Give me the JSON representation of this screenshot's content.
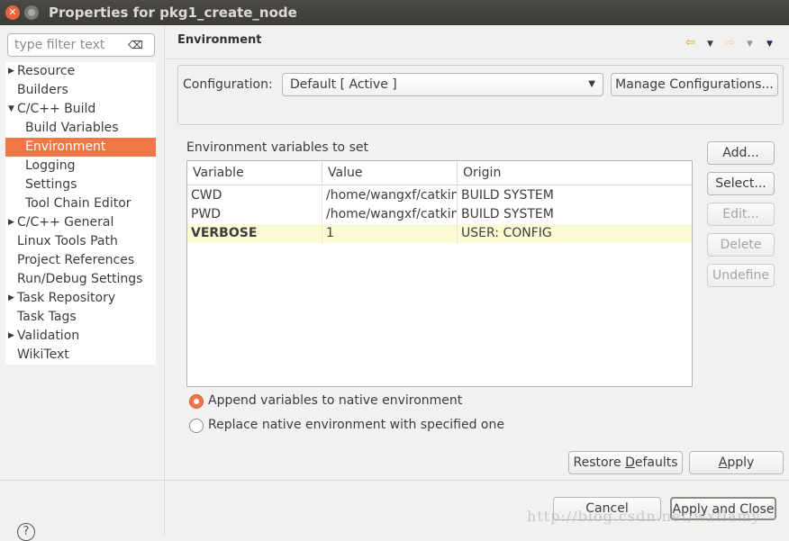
{
  "window": {
    "title": "Properties for pkg1_create_node"
  },
  "filter": {
    "placeholder": "type filter text"
  },
  "tree": [
    {
      "label": "Resource",
      "arrow": "▶",
      "sub": false
    },
    {
      "label": "Builders",
      "arrow": "",
      "sub": false
    },
    {
      "label": "C/C++ Build",
      "arrow": "▼",
      "sub": false
    },
    {
      "label": "Build Variables",
      "arrow": "",
      "sub": true
    },
    {
      "label": "Environment",
      "arrow": "",
      "sub": true,
      "selected": true
    },
    {
      "label": "Logging",
      "arrow": "",
      "sub": true
    },
    {
      "label": "Settings",
      "arrow": "",
      "sub": true
    },
    {
      "label": "Tool Chain Editor",
      "arrow": "",
      "sub": true
    },
    {
      "label": "C/C++ General",
      "arrow": "▶",
      "sub": false
    },
    {
      "label": "Linux Tools Path",
      "arrow": "",
      "sub": false
    },
    {
      "label": "Project References",
      "arrow": "",
      "sub": false
    },
    {
      "label": "Run/Debug Settings",
      "arrow": "",
      "sub": false
    },
    {
      "label": "Task Repository",
      "arrow": "▶",
      "sub": false
    },
    {
      "label": "Task Tags",
      "arrow": "",
      "sub": false
    },
    {
      "label": "Validation",
      "arrow": "▶",
      "sub": false
    },
    {
      "label": "WikiText",
      "arrow": "",
      "sub": false
    }
  ],
  "page": {
    "title": "Environment",
    "configuration_label": "Configuration:",
    "configuration_value": "Default  [ Active ]",
    "manage_label": "Manage Configurations...",
    "env_label": "Environment variables to set"
  },
  "table": {
    "columns": [
      "Variable",
      "Value",
      "Origin"
    ],
    "rows": [
      {
        "variable": "CWD",
        "value": "/home/wangxf/catkin",
        "origin": "BUILD SYSTEM",
        "user": false
      },
      {
        "variable": "PWD",
        "value": "/home/wangxf/catkin",
        "origin": "BUILD SYSTEM",
        "user": false
      },
      {
        "variable": "VERBOSE",
        "value": "1",
        "origin": "USER: CONFIG",
        "user": true
      }
    ]
  },
  "side_buttons": {
    "add": "Add...",
    "select": "Select...",
    "edit": "Edit...",
    "delete": "Delete",
    "undefine": "Undefine"
  },
  "radios": {
    "append": "Append variables to native environment",
    "replace": "Replace native environment with specified one",
    "selected": "append"
  },
  "buttons": {
    "restore_pre": "Restore ",
    "restore_u": "D",
    "restore_post": "efaults",
    "apply_u": "A",
    "apply_post": "pply",
    "cancel": "Cancel",
    "apply_close": "Apply and Close"
  },
  "watermark": "http://blog.csdn.net/wxflamy",
  "colors": {
    "accent": "#f07746",
    "highlight_row": "#fdfbd4"
  }
}
